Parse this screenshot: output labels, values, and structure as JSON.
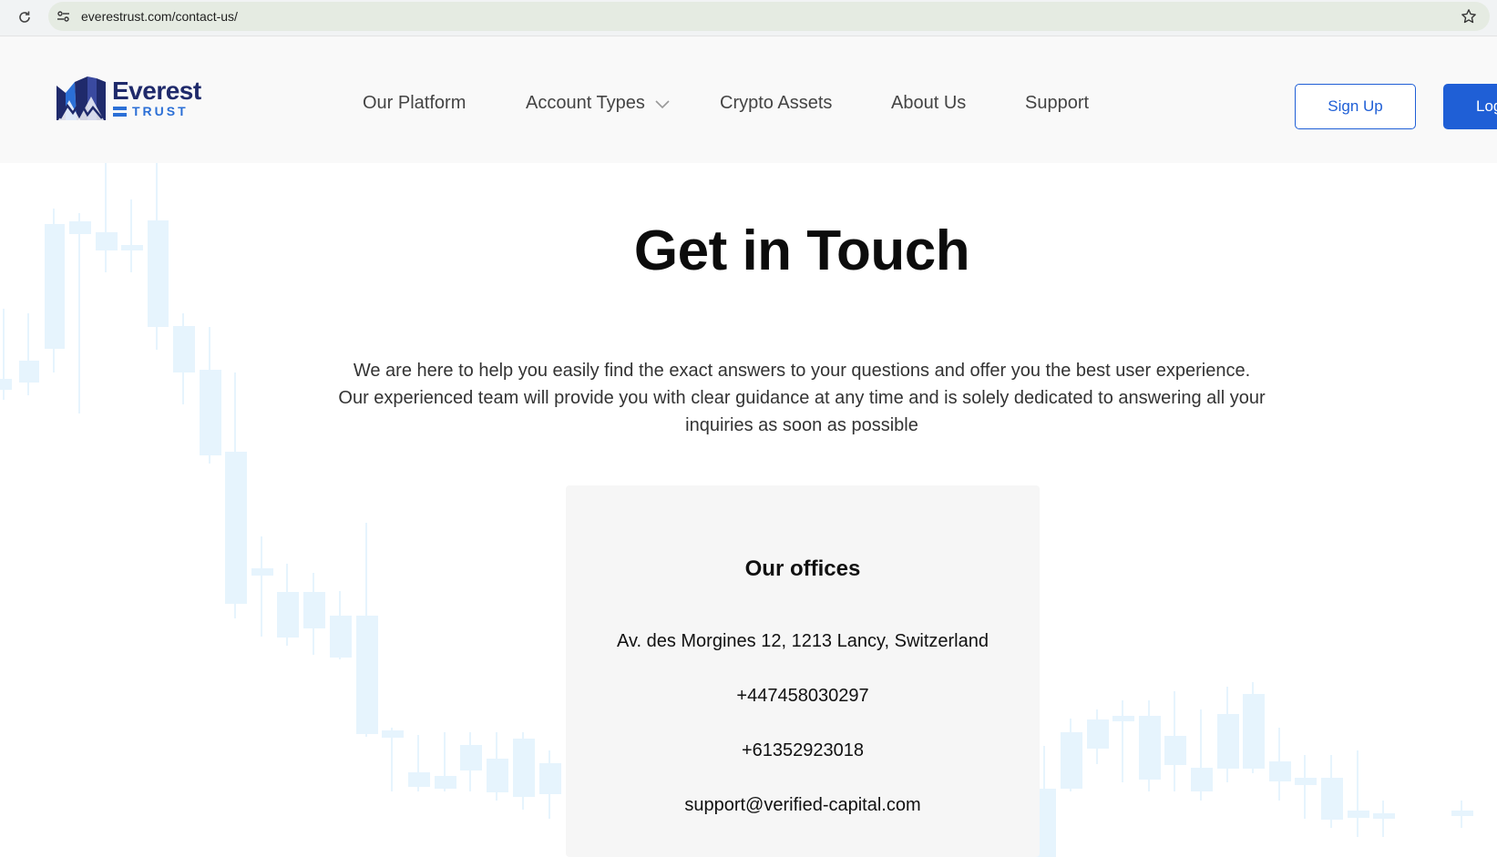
{
  "browser": {
    "url": "everestrust.com/contact-us/"
  },
  "header": {
    "logo_word": "Everest",
    "logo_sub": "TRUST",
    "nav": [
      "Our Platform",
      "Account Types",
      "Crypto Assets",
      "About Us",
      "Support"
    ],
    "signup_label": "Sign Up",
    "login_label": "Log"
  },
  "main": {
    "title": "Get in Touch",
    "intro": "We are here to help you easily find the exact answers to your questions and offer you the best user experience. Our experienced team will provide you with clear guidance at any time and is solely dedicated to answering all your inquiries as soon as possible",
    "offices": {
      "title": "Our offices",
      "address": "Av. des Morgines 12, 1213 Lancy, Switzerland",
      "phone1": "+447458030297",
      "phone2": "+61352923018",
      "email": "support@verified-capital.com"
    }
  },
  "colors": {
    "primary": "#1f5fd6",
    "logo_dark": "#1f2a6b",
    "candle": "#e6f4fd"
  },
  "icons": [
    "reload-icon",
    "site-info-icon",
    "star-icon",
    "chevron-down-icon"
  ]
}
